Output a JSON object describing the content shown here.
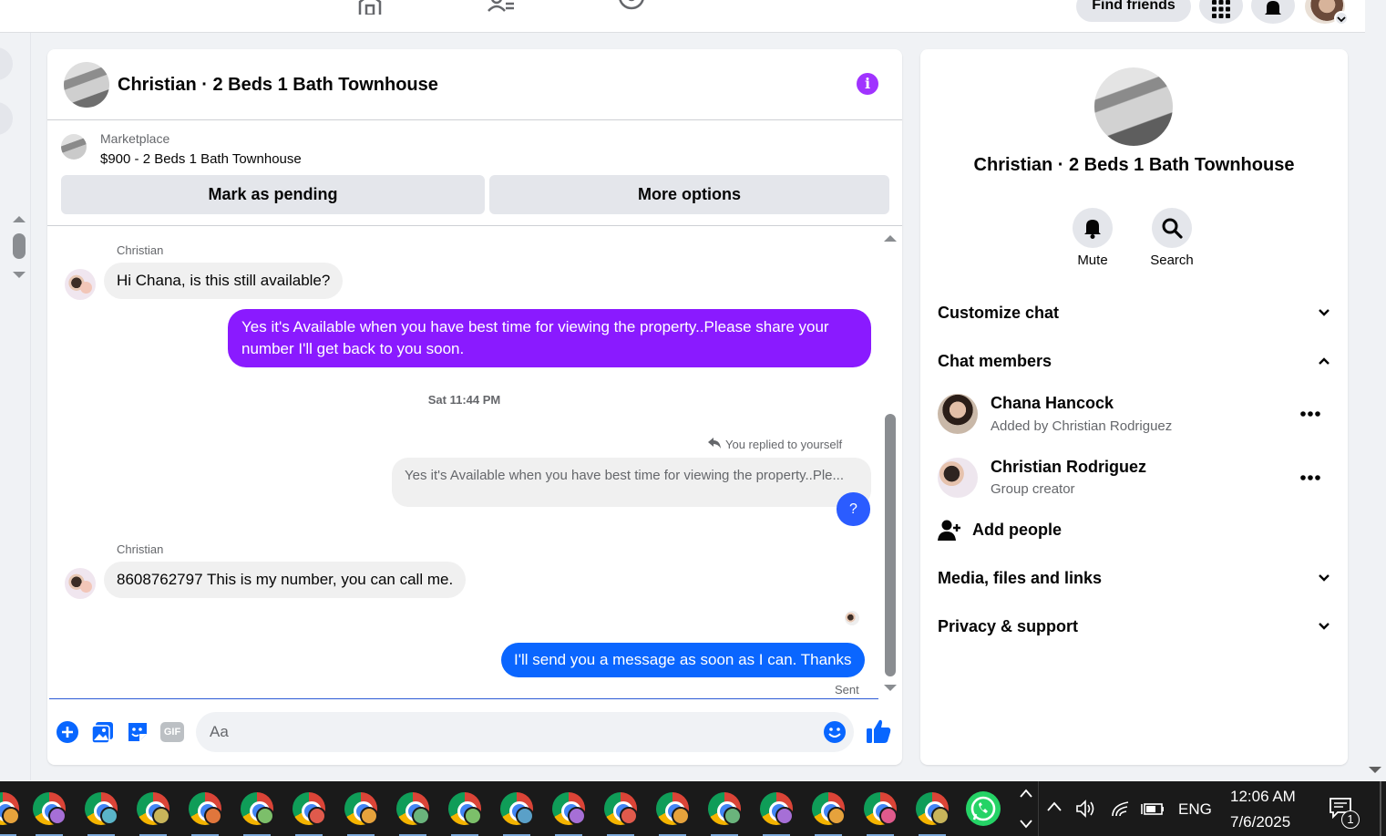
{
  "topbar": {
    "find_friends_label": "Find friends"
  },
  "chat": {
    "title": "Christian · 2 Beds 1 Bath Townhouse",
    "marketplace": {
      "label": "Marketplace",
      "item": "$900 - 2 Beds 1 Bath Townhouse",
      "mark_pending_label": "Mark as pending",
      "more_options_label": "More options"
    },
    "messages": {
      "sender1": "Christian",
      "msg1": "Hi Chana, is this still available?",
      "reply1": "Yes it's Available when you have best time for viewing the property..Please share your number I'll get back to you soon.",
      "timestamp": "Sat 11:44 PM",
      "replied_label": "You replied to yourself",
      "quoted_text": "Yes it's Available when you have best time for viewing the property..Ple...",
      "q_text": "?",
      "sender2": "Christian",
      "msg2": "8608762797 This is my number, you can call me.",
      "reply2": "I'll send you a message as soon as I can. Thanks",
      "sent_label": "Sent"
    },
    "composer": {
      "placeholder": "Aa",
      "gif_label": "GIF"
    }
  },
  "info_panel": {
    "title": "Christian · 2 Beds 1 Bath Townhouse",
    "mute_label": "Mute",
    "search_label": "Search",
    "customize_chat": "Customize chat",
    "chat_members": "Chat members",
    "members": [
      {
        "name": "Chana Hancock",
        "sub": "Added by Christian Rodriguez"
      },
      {
        "name": "Christian Rodriguez",
        "sub": "Group creator"
      }
    ],
    "add_people": "Add people",
    "media_files_links": "Media, files and links",
    "privacy_support": "Privacy & support"
  },
  "taskbar": {
    "language": "ENG",
    "time": "12:06 AM",
    "date": "7/6/2025",
    "notification_count": "1"
  },
  "colors": {
    "accent_purple": "#8a1aff",
    "accent_blue": "#0a66ff",
    "icon_blue": "#0866ff"
  }
}
